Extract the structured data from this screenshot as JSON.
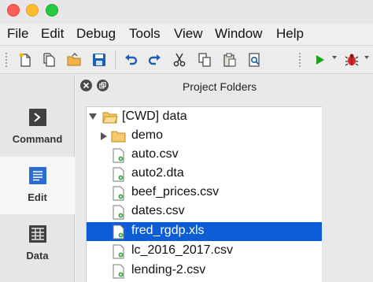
{
  "menu": [
    "File",
    "Edit",
    "Debug",
    "Tools",
    "View",
    "Window",
    "Help"
  ],
  "toolbar": {
    "icons": [
      "new-file-icon",
      "open-file-icon",
      "open-folder-icon",
      "save-icon",
      "undo-icon",
      "redo-icon",
      "cut-icon",
      "copy-icon",
      "paste-icon",
      "find-icon",
      "run-icon",
      "debug-icon"
    ],
    "accent_colors": {
      "save": "#1a5fb4",
      "undo": "#1a5fb4",
      "run": "#19a31f",
      "debug": "#d7262a"
    }
  },
  "sidebar": {
    "items": [
      {
        "label": "Command",
        "icon": "command-icon"
      },
      {
        "label": "Edit",
        "icon": "document-icon",
        "active": true
      },
      {
        "label": "Data",
        "icon": "table-icon"
      }
    ]
  },
  "panel": {
    "title": "Project Folders",
    "tree": [
      {
        "label": "[CWD] data",
        "type": "folder",
        "expanded": true,
        "level": 0
      },
      {
        "label": "demo",
        "type": "folder",
        "expanded": false,
        "level": 1
      },
      {
        "label": "auto.csv",
        "type": "file",
        "level": 1
      },
      {
        "label": "auto2.dta",
        "type": "file",
        "level": 1
      },
      {
        "label": "beef_prices.csv",
        "type": "file",
        "level": 1
      },
      {
        "label": "dates.csv",
        "type": "file",
        "level": 1
      },
      {
        "label": "fred_rgdp.xls",
        "type": "file",
        "level": 1,
        "selected": true
      },
      {
        "label": "lc_2016_2017.csv",
        "type": "file",
        "level": 1
      },
      {
        "label": "lending-2.csv",
        "type": "file",
        "level": 1
      }
    ],
    "selection_color": "#0d5ed6"
  }
}
